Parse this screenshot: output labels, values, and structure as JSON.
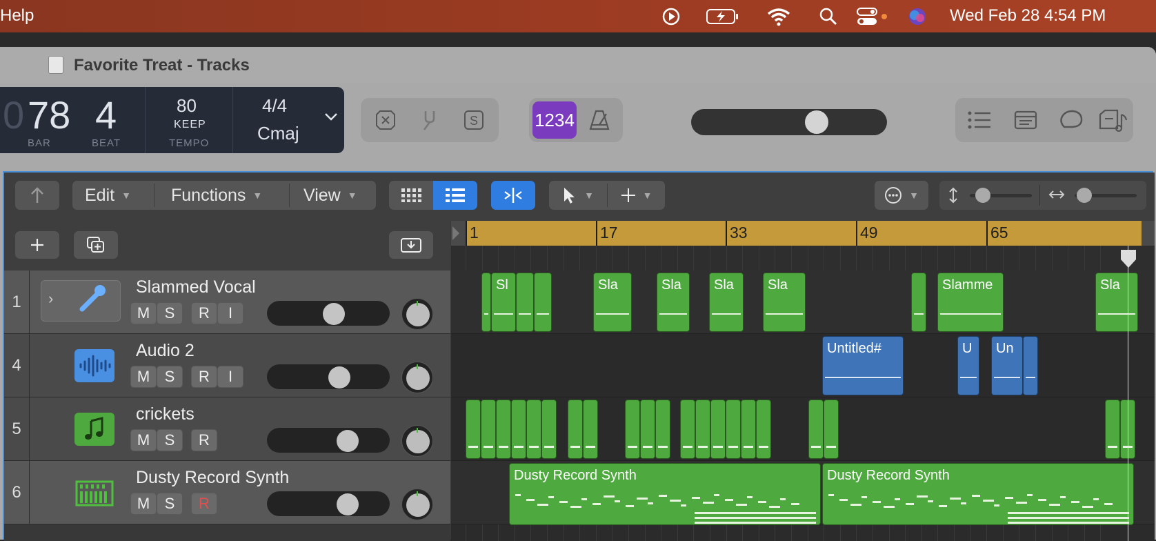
{
  "menubar": {
    "help_label": "Help",
    "clock": "Wed Feb 28  4:54 PM",
    "icons": [
      "play-circle-icon",
      "battery-icon",
      "wifi-icon",
      "search-icon",
      "control-center-icon",
      "siri-icon"
    ]
  },
  "window": {
    "title": "Favorite Treat - Tracks"
  },
  "lcd": {
    "bar_value": "78",
    "bar_prefix": "0",
    "beat_value": "4",
    "bar_label": "BAR",
    "beat_label": "BEAT",
    "tempo_value": "80",
    "tempo_mode": "KEEP",
    "tempo_label": "TEMPO",
    "signature": "4/4",
    "key": "Cmaj"
  },
  "toolbar": {
    "edit_label": "Edit",
    "functions_label": "Functions",
    "view_label": "View",
    "countin_label": "1234"
  },
  "master_volume": 0.67,
  "tracks": [
    {
      "number": "1",
      "name": "Slammed Vocal",
      "buttons": [
        "M",
        "S",
        "R",
        "I"
      ],
      "volume": 0.56
    },
    {
      "number": "4",
      "name": "Audio 2",
      "buttons": [
        "M",
        "S",
        "R",
        "I"
      ],
      "volume": 0.62
    },
    {
      "number": "5",
      "name": "crickets",
      "buttons": [
        "M",
        "S",
        "R"
      ],
      "volume": 0.7
    },
    {
      "number": "6",
      "name": "Dusty Record Synth",
      "buttons": [
        "M",
        "S",
        "R"
      ],
      "volume": 0.7
    }
  ],
  "ruler": {
    "bars": [
      "1",
      "17",
      "33",
      "49",
      "65"
    ]
  },
  "regions": {
    "vocal": [
      "Sl",
      "Sla",
      "Sla",
      "Sla",
      "Sla",
      "Slamme",
      "Sla"
    ],
    "audio2": [
      "Untitled#",
      "U",
      "Un"
    ],
    "synth": [
      "Dusty Record Synth",
      "Dusty Record Synth"
    ]
  },
  "colors": {
    "accent": "#4a90d9",
    "region_green": "#4ea93e",
    "region_blue": "#3f74b8",
    "ruler": "#c49a3a",
    "countin_purple": "#7a3bbf"
  }
}
